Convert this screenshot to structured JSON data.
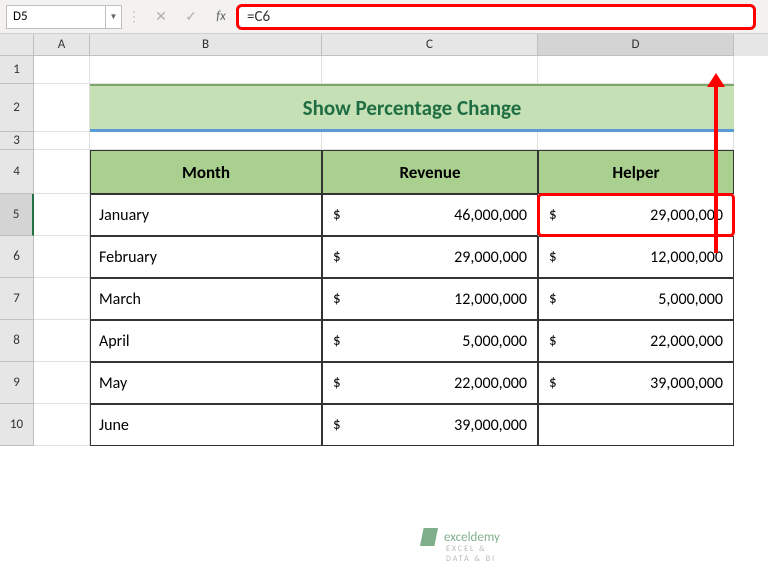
{
  "name_box": "D5",
  "formula": "=C6",
  "fx": "fx",
  "cols": {
    "A": "A",
    "B": "B",
    "C": "C",
    "D": "D"
  },
  "rows": [
    "1",
    "2",
    "3",
    "4",
    "5",
    "6",
    "7",
    "8",
    "9",
    "10"
  ],
  "title": "Show Percentage Change",
  "headers": {
    "month": "Month",
    "revenue": "Revenue",
    "helper": "Helper"
  },
  "currency": "$",
  "data": [
    {
      "month": "January",
      "revenue": "46,000,000",
      "helper": "29,000,000"
    },
    {
      "month": "February",
      "revenue": "29,000,000",
      "helper": "12,000,000"
    },
    {
      "month": "March",
      "revenue": "12,000,000",
      "helper": "5,000,000"
    },
    {
      "month": "April",
      "revenue": "5,000,000",
      "helper": "22,000,000"
    },
    {
      "month": "May",
      "revenue": "22,000,000",
      "helper": "39,000,000"
    },
    {
      "month": "June",
      "revenue": "39,000,000",
      "helper": ""
    }
  ],
  "watermark": {
    "brand": "exceldemy",
    "sub": "EXCEL & DATA & BI"
  },
  "chart_data": {
    "type": "table",
    "title": "Show Percentage Change",
    "columns": [
      "Month",
      "Revenue",
      "Helper"
    ],
    "rows": [
      [
        "January",
        46000000,
        29000000
      ],
      [
        "February",
        29000000,
        12000000
      ],
      [
        "March",
        12000000,
        5000000
      ],
      [
        "April",
        5000000,
        22000000
      ],
      [
        "May",
        22000000,
        39000000
      ],
      [
        "June",
        39000000,
        null
      ]
    ],
    "note": "Helper column formula in D5: =C6"
  }
}
